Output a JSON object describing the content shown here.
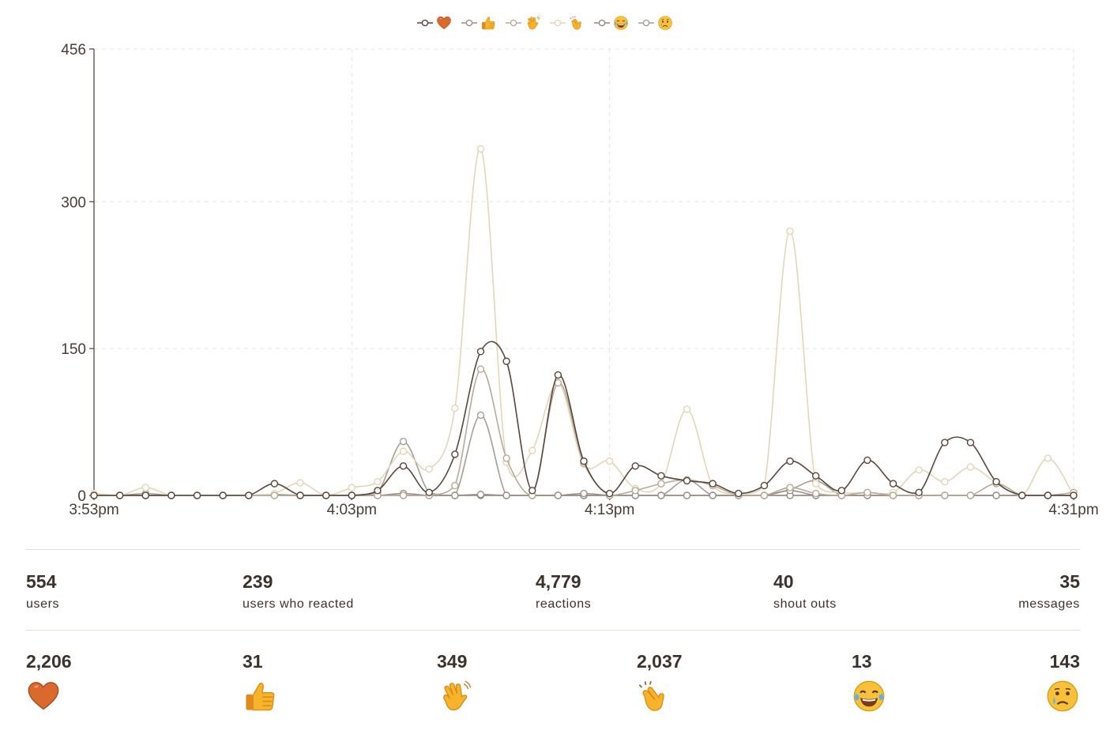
{
  "chart_data": {
    "type": "line",
    "xlabel": "",
    "ylabel": "",
    "ylim": [
      0,
      456
    ],
    "yticks": [
      0,
      150,
      300,
      456
    ],
    "x_tick_labels": [
      "3:53pm",
      "4:03pm",
      "4:13pm",
      "4:31pm"
    ],
    "x_start": "3:53pm",
    "x_end": "4:31pm",
    "grid": true,
    "legend_position": "top-center",
    "x": [
      "3:53pm",
      "3:54pm",
      "3:55pm",
      "3:56pm",
      "3:57pm",
      "3:58pm",
      "3:59pm",
      "4:00pm",
      "4:01pm",
      "4:02pm",
      "4:03pm",
      "4:04pm",
      "4:05pm",
      "4:06pm",
      "4:07pm",
      "4:08pm",
      "4:09pm",
      "4:10pm",
      "4:11pm",
      "4:12pm",
      "4:13pm",
      "4:14pm",
      "4:15pm",
      "4:16pm",
      "4:17pm",
      "4:18pm",
      "4:19pm",
      "4:20pm",
      "4:21pm",
      "4:22pm",
      "4:23pm",
      "4:24pm",
      "4:25pm",
      "4:26pm",
      "4:27pm",
      "4:28pm",
      "4:29pm",
      "4:30pm",
      "4:31pm"
    ],
    "series": [
      {
        "name": "heart",
        "icon": "heart-icon",
        "color": "#5a4538",
        "values": [
          0,
          0,
          0,
          0,
          0,
          0,
          0,
          12,
          0,
          0,
          0,
          5,
          30,
          3,
          42,
          147,
          137,
          5,
          123,
          35,
          2,
          30,
          20,
          15,
          12,
          2,
          10,
          35,
          20,
          5,
          36,
          12,
          3,
          54,
          54,
          14,
          0,
          0,
          0
        ]
      },
      {
        "name": "thumbs-up",
        "icon": "thumbs-up-icon",
        "color": "#9c8f86",
        "values": [
          0,
          0,
          0,
          0,
          0,
          0,
          0,
          0,
          0,
          0,
          0,
          0,
          2,
          0,
          0,
          1,
          0,
          0,
          0,
          2,
          0,
          0,
          0,
          0,
          0,
          0,
          0,
          5,
          0,
          0,
          0,
          0,
          0,
          0,
          0,
          0,
          0,
          0,
          0
        ]
      },
      {
        "name": "wave",
        "icon": "wave-icon",
        "color": "#b8aa97",
        "values": [
          0,
          0,
          0,
          0,
          0,
          0,
          0,
          0,
          0,
          0,
          0,
          0,
          0,
          0,
          10,
          129,
          38,
          0,
          115,
          33,
          0,
          5,
          12,
          16,
          10,
          0,
          0,
          8,
          2,
          0,
          3,
          0,
          0,
          0,
          0,
          12,
          0,
          0,
          3
        ]
      },
      {
        "name": "clap",
        "icon": "clap-icon",
        "color": "#e3d6b8",
        "values": [
          2,
          0,
          8,
          0,
          0,
          0,
          0,
          2,
          13,
          0,
          8,
          14,
          45,
          27,
          89,
          354,
          34,
          46,
          115,
          32,
          35,
          7,
          12,
          88,
          10,
          2,
          10,
          270,
          12,
          3,
          3,
          3,
          26,
          14,
          29,
          13,
          0,
          38,
          0
        ]
      },
      {
        "name": "joy",
        "icon": "joy-icon",
        "color": "#948a82",
        "values": [
          0,
          0,
          0,
          0,
          0,
          0,
          0,
          0,
          0,
          0,
          0,
          0,
          0,
          0,
          0,
          0,
          0,
          0,
          0,
          0,
          0,
          0,
          0,
          0,
          0,
          0,
          0,
          0,
          0,
          0,
          0,
          0,
          0,
          0,
          0,
          0,
          0,
          0,
          0
        ]
      },
      {
        "name": "cry",
        "icon": "cry-icon",
        "color": "#a69d95",
        "values": [
          0,
          0,
          2,
          0,
          0,
          0,
          0,
          1,
          0,
          0,
          0,
          3,
          55,
          3,
          0,
          82,
          0,
          0,
          0,
          0,
          0,
          0,
          0,
          16,
          0,
          0,
          0,
          6,
          15,
          0,
          0,
          0,
          0,
          0,
          0,
          0,
          0,
          0,
          0
        ]
      }
    ]
  },
  "stats": [
    {
      "value": "554",
      "label": "users"
    },
    {
      "value": "239",
      "label": "users who reacted"
    },
    {
      "value": "4,779",
      "label": "reactions"
    },
    {
      "value": "40",
      "label": "shout outs"
    },
    {
      "value": "35",
      "label": "messages"
    }
  ],
  "reactions": [
    {
      "value": "2,206",
      "icon": "heart-icon"
    },
    {
      "value": "31",
      "icon": "thumbs-up-icon"
    },
    {
      "value": "349",
      "icon": "wave-icon"
    },
    {
      "value": "2,037",
      "icon": "clap-icon"
    },
    {
      "value": "13",
      "icon": "joy-icon"
    },
    {
      "value": "143",
      "icon": "cry-icon"
    }
  ]
}
